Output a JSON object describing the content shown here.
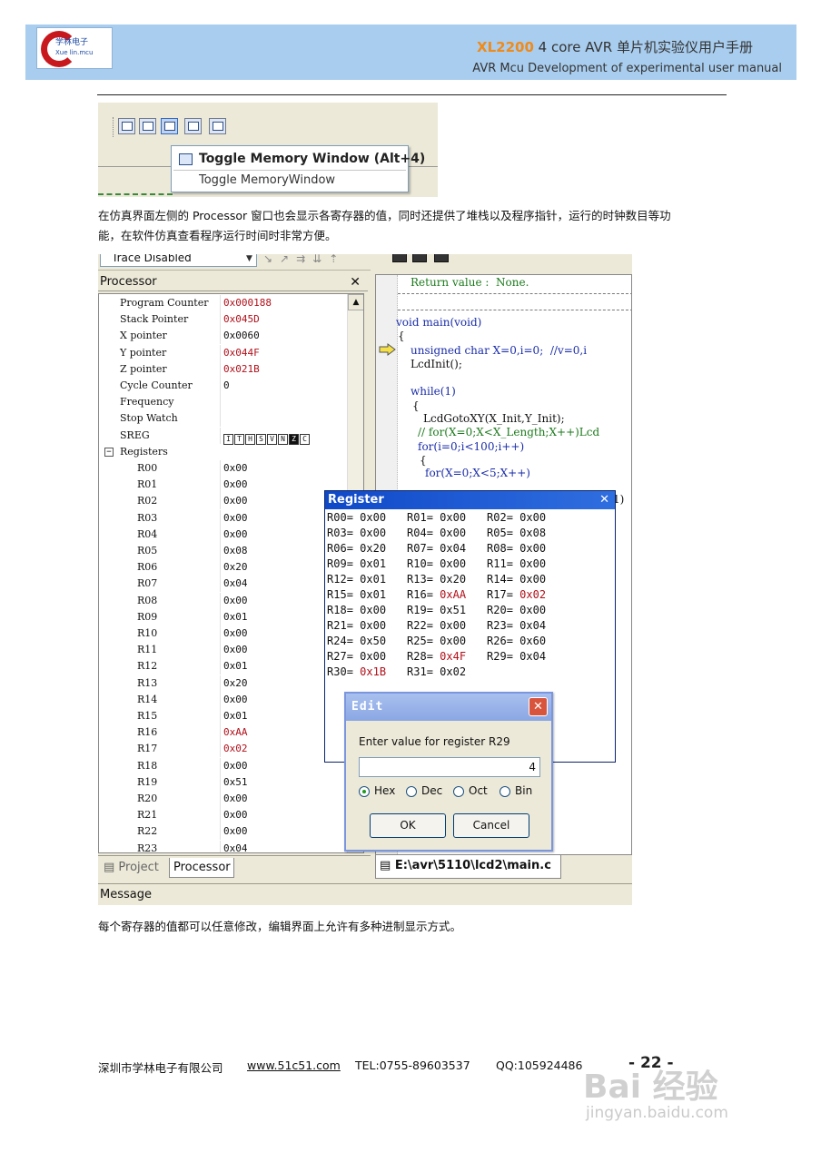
{
  "header": {
    "logo_cn": "学林电子",
    "logo_en": "Xue lin.mcu",
    "model": "XL2200",
    "title_rest": " 4 core AVR 单片机实验仪用户手册",
    "subtitle": "AVR Mcu Development of experimental user manual"
  },
  "shot1": {
    "tooltip_title": "Toggle Memory Window (Alt+4)",
    "tooltip_sub": "Toggle MemoryWindow"
  },
  "text": {
    "para1_line1": "在仿真界面左侧的 Processor 窗口也会显示各寄存器的值，同时还提供了堆栈以及程序指针，运行的时钟数目等功",
    "para1_line2": "能，在软件仿真查看程序运行时间时非常方便。",
    "para2": "每个寄存器的值都可以任意修改，编辑界面上允许有多种进制显示方式。"
  },
  "toolbar": {
    "trace_label": "Trace Disabled"
  },
  "processor": {
    "title": "Processor",
    "close": "✕",
    "rows": [
      {
        "name": "Program Counter",
        "value": "0x000188",
        "red": true
      },
      {
        "name": "Stack Pointer",
        "value": "0x045D",
        "red": true
      },
      {
        "name": "X pointer",
        "value": "0x0060",
        "red": false
      },
      {
        "name": "Y pointer",
        "value": "0x044F",
        "red": true
      },
      {
        "name": "Z pointer",
        "value": "0x021B",
        "red": true
      },
      {
        "name": "Cycle Counter",
        "value": "0",
        "red": false
      },
      {
        "name": "Frequency",
        "value": "",
        "red": false
      },
      {
        "name": "Stop Watch",
        "value": "",
        "red": false
      },
      {
        "name": "SREG",
        "value": "",
        "red": false
      }
    ],
    "sreg_flags": [
      "I",
      "T",
      "H",
      "S",
      "V",
      "N",
      "Z",
      "C"
    ],
    "sreg_on": [
      "Z"
    ],
    "registers_label": "Registers",
    "registers": [
      {
        "name": "R00",
        "value": "0x00",
        "red": false
      },
      {
        "name": "R01",
        "value": "0x00",
        "red": false
      },
      {
        "name": "R02",
        "value": "0x00",
        "red": false
      },
      {
        "name": "R03",
        "value": "0x00",
        "red": false
      },
      {
        "name": "R04",
        "value": "0x00",
        "red": false
      },
      {
        "name": "R05",
        "value": "0x08",
        "red": false
      },
      {
        "name": "R06",
        "value": "0x20",
        "red": false
      },
      {
        "name": "R07",
        "value": "0x04",
        "red": false
      },
      {
        "name": "R08",
        "value": "0x00",
        "red": false
      },
      {
        "name": "R09",
        "value": "0x01",
        "red": false
      },
      {
        "name": "R10",
        "value": "0x00",
        "red": false
      },
      {
        "name": "R11",
        "value": "0x00",
        "red": false
      },
      {
        "name": "R12",
        "value": "0x01",
        "red": false
      },
      {
        "name": "R13",
        "value": "0x20",
        "red": false
      },
      {
        "name": "R14",
        "value": "0x00",
        "red": false
      },
      {
        "name": "R15",
        "value": "0x01",
        "red": false
      },
      {
        "name": "R16",
        "value": "0xAA",
        "red": true
      },
      {
        "name": "R17",
        "value": "0x02",
        "red": true
      },
      {
        "name": "R18",
        "value": "0x00",
        "red": false
      },
      {
        "name": "R19",
        "value": "0x51",
        "red": false
      },
      {
        "name": "R20",
        "value": "0x00",
        "red": false
      },
      {
        "name": "R21",
        "value": "0x00",
        "red": false
      },
      {
        "name": "R22",
        "value": "0x00",
        "red": false
      },
      {
        "name": "R23",
        "value": "0x04",
        "red": false
      }
    ]
  },
  "bottom_tabs": {
    "project": "Project",
    "processor": "Processor",
    "file": "E:\\avr\\5110\\lcd2\\main.c",
    "message": "Message"
  },
  "code": {
    "lines": [
      {
        "text": "Return value :  None.",
        "cls": "cm"
      },
      {
        "text": "void main(void)",
        "cls": "kw"
      },
      {
        "text": "{",
        "cls": ""
      },
      {
        "text": "unsigned char X=0,i=0;  //v=0,i",
        "cls": "kw"
      },
      {
        "text": "LcdInit();",
        "cls": ""
      },
      {
        "text": "while(1)",
        "cls": "kw"
      },
      {
        "text": "{",
        "cls": ""
      },
      {
        "text": "LcdGotoXY(X_Init,Y_Init);",
        "cls": ""
      },
      {
        "text": "// for(X=0;X<X_Length;X++)Lcd",
        "cls": "cm"
      },
      {
        "text": "for(i=0;i<100;i++)",
        "cls": "kw"
      },
      {
        "text": "{",
        "cls": ""
      },
      {
        "text": "for(X=0;X<5;X++)",
        "cls": "kw"
      },
      {
        "text": "1)",
        "cls": ""
      }
    ]
  },
  "register_window": {
    "title": "Register",
    "close": "✕",
    "rows": [
      [
        {
          "n": "R00",
          "v": "0x00",
          "red": false
        },
        {
          "n": "R01",
          "v": "0x00",
          "red": false
        },
        {
          "n": "R02",
          "v": "0x00",
          "red": false
        }
      ],
      [
        {
          "n": "R03",
          "v": "0x00",
          "red": false
        },
        {
          "n": "R04",
          "v": "0x00",
          "red": false
        },
        {
          "n": "R05",
          "v": "0x08",
          "red": false
        }
      ],
      [
        {
          "n": "R06",
          "v": "0x20",
          "red": false
        },
        {
          "n": "R07",
          "v": "0x04",
          "red": false
        },
        {
          "n": "R08",
          "v": "0x00",
          "red": false
        }
      ],
      [
        {
          "n": "R09",
          "v": "0x01",
          "red": false
        },
        {
          "n": "R10",
          "v": "0x00",
          "red": false
        },
        {
          "n": "R11",
          "v": "0x00",
          "red": false
        }
      ],
      [
        {
          "n": "R12",
          "v": "0x01",
          "red": false
        },
        {
          "n": "R13",
          "v": "0x20",
          "red": false
        },
        {
          "n": "R14",
          "v": "0x00",
          "red": false
        }
      ],
      [
        {
          "n": "R15",
          "v": "0x01",
          "red": false
        },
        {
          "n": "R16",
          "v": "0xAA",
          "red": true
        },
        {
          "n": "R17",
          "v": "0x02",
          "red": true
        }
      ],
      [
        {
          "n": "R18",
          "v": "0x00",
          "red": false
        },
        {
          "n": "R19",
          "v": "0x51",
          "red": false
        },
        {
          "n": "R20",
          "v": "0x00",
          "red": false
        }
      ],
      [
        {
          "n": "R21",
          "v": "0x00",
          "red": false
        },
        {
          "n": "R22",
          "v": "0x00",
          "red": false
        },
        {
          "n": "R23",
          "v": "0x04",
          "red": false
        }
      ],
      [
        {
          "n": "R24",
          "v": "0x50",
          "red": false
        },
        {
          "n": "R25",
          "v": "0x00",
          "red": false
        },
        {
          "n": "R26",
          "v": "0x60",
          "red": false
        }
      ],
      [
        {
          "n": "R27",
          "v": "0x00",
          "red": false
        },
        {
          "n": "R28",
          "v": "0x4F",
          "red": true
        },
        {
          "n": "R29",
          "v": "0x04",
          "red": false
        }
      ],
      [
        {
          "n": "R30",
          "v": "0x1B",
          "red": true
        },
        {
          "n": "R31",
          "v": "0x02",
          "red": false
        }
      ]
    ]
  },
  "edit_dialog": {
    "title": "Edit",
    "close": "✕",
    "prompt": "Enter value for register R29",
    "value": "4",
    "radios": [
      "Hex",
      "Dec",
      "Oct",
      "Bin"
    ],
    "selected": "Hex",
    "ok": "OK",
    "cancel": "Cancel"
  },
  "footer": {
    "company": "深圳市学林电子有限公司",
    "url": "www.51c51.com",
    "tel": "TEL:0755-89603537",
    "qq": "QQ:105924486",
    "page": "- 22 -"
  },
  "watermark": {
    "brand": "Bai 经验",
    "url": "jingyan.baidu.com"
  }
}
